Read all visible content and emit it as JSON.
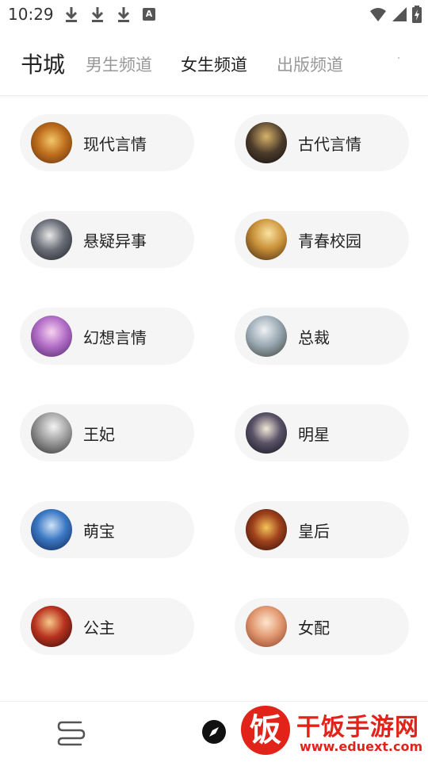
{
  "status_bar": {
    "time": "10:29",
    "icons": [
      "download-icon",
      "download-icon",
      "download-icon",
      "a-icon",
      "wifi-icon",
      "signal-icon",
      "battery-icon"
    ],
    "a_label": "A"
  },
  "header": {
    "title": "书城",
    "tabs": [
      {
        "label": "男生频道",
        "active": false
      },
      {
        "label": "女生频道",
        "active": true
      },
      {
        "label": "出版频道",
        "active": false
      }
    ]
  },
  "categories": [
    {
      "label": "现代言情",
      "cover": "book-cover"
    },
    {
      "label": "古代言情",
      "cover": "book-cover"
    },
    {
      "label": "悬疑异事",
      "cover": "book-cover"
    },
    {
      "label": "青春校园",
      "cover": "book-cover"
    },
    {
      "label": "幻想言情",
      "cover": "book-cover"
    },
    {
      "label": "总裁",
      "cover": "book-cover"
    },
    {
      "label": "王妃",
      "cover": "book-cover"
    },
    {
      "label": "明星",
      "cover": "book-cover"
    },
    {
      "label": "萌宝",
      "cover": "book-cover"
    },
    {
      "label": "皇后",
      "cover": "book-cover"
    },
    {
      "label": "公主",
      "cover": "book-cover"
    },
    {
      "label": "女配",
      "cover": "book-cover"
    }
  ],
  "bottom_nav": {
    "items": [
      "bookshelf-icon",
      "compass-icon"
    ]
  },
  "watermark": {
    "logo_char": "饭",
    "title": "干饭手游网",
    "url": "www.eduext.com"
  }
}
